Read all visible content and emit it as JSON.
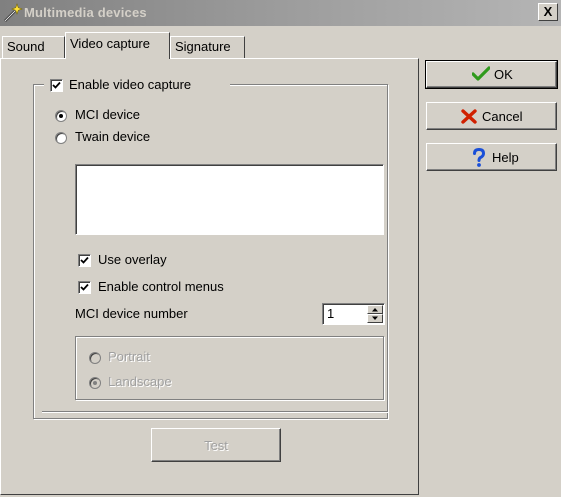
{
  "window": {
    "title": "Multimedia devices",
    "close_label": "X"
  },
  "tabs": [
    {
      "label": "Sound",
      "active": false
    },
    {
      "label": "Video capture",
      "active": true
    },
    {
      "label": "Signature",
      "active": false
    }
  ],
  "video_capture": {
    "enable_label": "Enable video capture",
    "enable_checked": true,
    "mci_label": "MCI device",
    "mci_selected": true,
    "twain_label": "Twain device",
    "twain_selected": false,
    "use_overlay_label": "Use overlay",
    "use_overlay_checked": true,
    "control_menus_label": "Enable control menus",
    "control_menus_checked": true,
    "mci_number_label": "MCI device number",
    "mci_number_value": "1",
    "portrait_label": "Portrait",
    "landscape_label": "Landscape",
    "landscape_selected": true,
    "test_label": "Test"
  },
  "buttons": {
    "ok_label": "OK",
    "cancel_label": "Cancel",
    "help_label": "Help"
  },
  "colors": {
    "ok_check": "#2f9a1c",
    "cancel_x": "#d02000",
    "help_q": "#1a4fd8",
    "title_text": "#d4d0c8"
  },
  "icons": {
    "title": "multimedia-wand-icon",
    "ok": "green-check-icon",
    "cancel": "red-x-icon",
    "help": "blue-question-icon"
  }
}
